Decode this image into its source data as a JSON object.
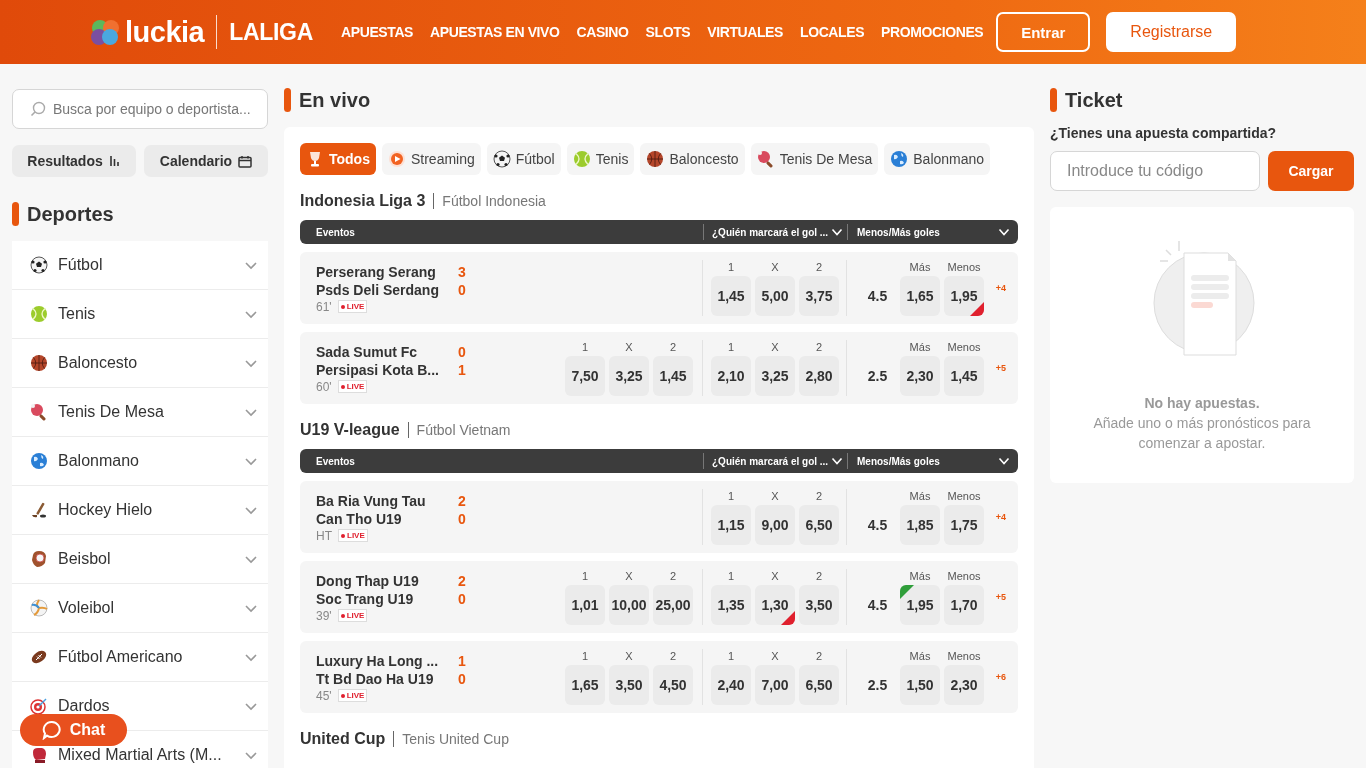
{
  "header": {
    "brand": "luckia",
    "partner": "LALIGA",
    "nav": [
      "APUESTAS",
      "APUESTAS EN VIVO",
      "CASINO",
      "SLOTS",
      "VIRTUALES",
      "LOCALES",
      "PROMOCIONES"
    ],
    "login": "Entrar",
    "register": "Registrarse"
  },
  "sidebar": {
    "search": {
      "placeholder": "Busca por equipo o deportista..."
    },
    "buttons": [
      {
        "label": "Resultados",
        "kind": "chart"
      },
      {
        "label": "Calendario",
        "kind": "calendar"
      }
    ],
    "title": "Deportes",
    "sports": [
      {
        "label": "Fútbol",
        "kind": "football"
      },
      {
        "label": "Tenis",
        "kind": "tennis"
      },
      {
        "label": "Baloncesto",
        "kind": "basketball"
      },
      {
        "label": "Tenis De Mesa",
        "kind": "table-tennis"
      },
      {
        "label": "Balonmano",
        "kind": "handball"
      },
      {
        "label": "Hockey Hielo",
        "kind": "hockey"
      },
      {
        "label": "Beisbol",
        "kind": "baseball"
      },
      {
        "label": "Voleibol",
        "kind": "volleyball"
      },
      {
        "label": "Fútbol Americano",
        "kind": "american-football"
      },
      {
        "label": "Dardos",
        "kind": "darts"
      },
      {
        "label": "Mixed Martial Arts (M...",
        "kind": "mma"
      }
    ]
  },
  "live": {
    "title": "En vivo",
    "filters": [
      {
        "label": "Todos",
        "kind": "trophy",
        "selected": true
      },
      {
        "label": "Streaming",
        "kind": "streaming",
        "selected": false
      },
      {
        "label": "Fútbol",
        "kind": "football",
        "selected": false
      },
      {
        "label": "Tenis",
        "kind": "tennis",
        "selected": false
      },
      {
        "label": "Baloncesto",
        "kind": "basketball",
        "selected": false
      },
      {
        "label": "Tenis De Mesa",
        "kind": "table-tennis",
        "selected": false
      },
      {
        "label": "Balonmano",
        "kind": "handball",
        "selected": false
      }
    ],
    "sections": [
      {
        "title": "Indonesia Liga 3",
        "subtitle": "Fútbol Indonesia",
        "columns": [
          "Eventos",
          "¿Quién marcará el gol ...",
          "Menos/Más goles"
        ],
        "events": [
          {
            "home": "Perserang Serang",
            "away": "Psds Deli Serdang",
            "home_score": "3",
            "away_score": "0",
            "time": "61'",
            "badge": "LIVE",
            "goal": {
              "labels": [
                "1",
                "X",
                "2"
              ],
              "odds": [
                {
                  "value": "1,45",
                  "rising": false,
                  "falling": false
                },
                {
                  "value": "5,00",
                  "rising": false,
                  "falling": false
                },
                {
                  "value": "3,75",
                  "rising": false,
                  "falling": false
                }
              ]
            },
            "total": {
              "line": "4.5",
              "labels": [
                "Más",
                "Menos"
              ],
              "odds": [
                {
                  "value": "1,65",
                  "rising": false,
                  "falling": false
                },
                {
                  "value": "1,95",
                  "rising": false,
                  "falling": true
                }
              ]
            },
            "more": "+4"
          },
          {
            "home": "Sada Sumut Fc",
            "away": "Persipasi Kota B...",
            "home_score": "0",
            "away_score": "1",
            "time": "60'",
            "badge": "LIVE",
            "result": {
              "labels": [
                "1",
                "X",
                "2"
              ],
              "odds": [
                {
                  "value": "7,50",
                  "rising": false,
                  "falling": false
                },
                {
                  "value": "3,25",
                  "rising": false,
                  "falling": false
                },
                {
                  "value": "1,45",
                  "rising": false,
                  "falling": false
                }
              ]
            },
            "goal": {
              "labels": [
                "1",
                "X",
                "2"
              ],
              "odds": [
                {
                  "value": "2,10",
                  "rising": false,
                  "falling": false
                },
                {
                  "value": "3,25",
                  "rising": false,
                  "falling": false
                },
                {
                  "value": "2,80",
                  "rising": false,
                  "falling": false
                }
              ]
            },
            "total": {
              "line": "2.5",
              "labels": [
                "Más",
                "Menos"
              ],
              "odds": [
                {
                  "value": "2,30",
                  "rising": false,
                  "falling": false
                },
                {
                  "value": "1,45",
                  "rising": false,
                  "falling": false
                }
              ]
            },
            "more": "+5"
          }
        ]
      },
      {
        "title": "U19 V-league",
        "subtitle": "Fútbol Vietnam",
        "columns": [
          "Eventos",
          "¿Quién marcará el gol ...",
          "Menos/Más goles"
        ],
        "events": [
          {
            "home": "Ba Ria Vung Tau",
            "away": "Can Tho U19",
            "home_score": "2",
            "away_score": "0",
            "time": "HT",
            "badge": "LIVE",
            "goal": {
              "labels": [
                "1",
                "X",
                "2"
              ],
              "odds": [
                {
                  "value": "1,15",
                  "rising": false,
                  "falling": false
                },
                {
                  "value": "9,00",
                  "rising": false,
                  "falling": false
                },
                {
                  "value": "6,50",
                  "rising": false,
                  "falling": false
                }
              ]
            },
            "total": {
              "line": "4.5",
              "labels": [
                "Más",
                "Menos"
              ],
              "odds": [
                {
                  "value": "1,85",
                  "rising": false,
                  "falling": false
                },
                {
                  "value": "1,75",
                  "rising": false,
                  "falling": false
                }
              ]
            },
            "more": "+4"
          },
          {
            "home": "Dong Thap U19",
            "away": "Soc Trang U19",
            "home_score": "2",
            "away_score": "0",
            "time": "39'",
            "badge": "LIVE",
            "result": {
              "labels": [
                "1",
                "X",
                "2"
              ],
              "odds": [
                {
                  "value": "1,01",
                  "rising": false,
                  "falling": false
                },
                {
                  "value": "10,00",
                  "rising": false,
                  "falling": false
                },
                {
                  "value": "25,00",
                  "rising": false,
                  "falling": false
                }
              ]
            },
            "goal": {
              "labels": [
                "1",
                "X",
                "2"
              ],
              "odds": [
                {
                  "value": "1,35",
                  "rising": false,
                  "falling": false
                },
                {
                  "value": "1,30",
                  "rising": false,
                  "falling": true
                },
                {
                  "value": "3,50",
                  "rising": false,
                  "falling": false
                }
              ]
            },
            "total": {
              "line": "4.5",
              "labels": [
                "Más",
                "Menos"
              ],
              "odds": [
                {
                  "value": "1,95",
                  "rising": true,
                  "falling": false
                },
                {
                  "value": "1,70",
                  "rising": false,
                  "falling": false
                }
              ]
            },
            "more": "+5"
          },
          {
            "home": "Luxury Ha Long ...",
            "away": "Tt Bd Dao Ha U19",
            "home_score": "1",
            "away_score": "0",
            "time": "45'",
            "badge": "LIVE",
            "result": {
              "labels": [
                "1",
                "X",
                "2"
              ],
              "odds": [
                {
                  "value": "1,65",
                  "rising": false,
                  "falling": false
                },
                {
                  "value": "3,50",
                  "rising": false,
                  "falling": false
                },
                {
                  "value": "4,50",
                  "rising": false,
                  "falling": false
                }
              ]
            },
            "goal": {
              "labels": [
                "1",
                "X",
                "2"
              ],
              "odds": [
                {
                  "value": "2,40",
                  "rising": false,
                  "falling": false
                },
                {
                  "value": "7,00",
                  "rising": false,
                  "falling": false
                },
                {
                  "value": "6,50",
                  "rising": false,
                  "falling": false
                }
              ]
            },
            "total": {
              "line": "2.5",
              "labels": [
                "Más",
                "Menos"
              ],
              "odds": [
                {
                  "value": "1,50",
                  "rising": false,
                  "falling": false
                },
                {
                  "value": "2,30",
                  "rising": false,
                  "falling": false
                }
              ]
            },
            "more": "+6"
          }
        ]
      },
      {
        "title": "United Cup",
        "subtitle": "Tenis United Cup"
      }
    ]
  },
  "ticket": {
    "title": "Ticket",
    "question": "¿Tienes una apuesta compartida?",
    "code_placeholder": "Introduce tu código",
    "load": "Cargar",
    "empty_title": "No hay apuestas.",
    "empty_text": "Añade uno o más pronósticos para comenzar a apostar."
  },
  "chat": "Chat"
}
